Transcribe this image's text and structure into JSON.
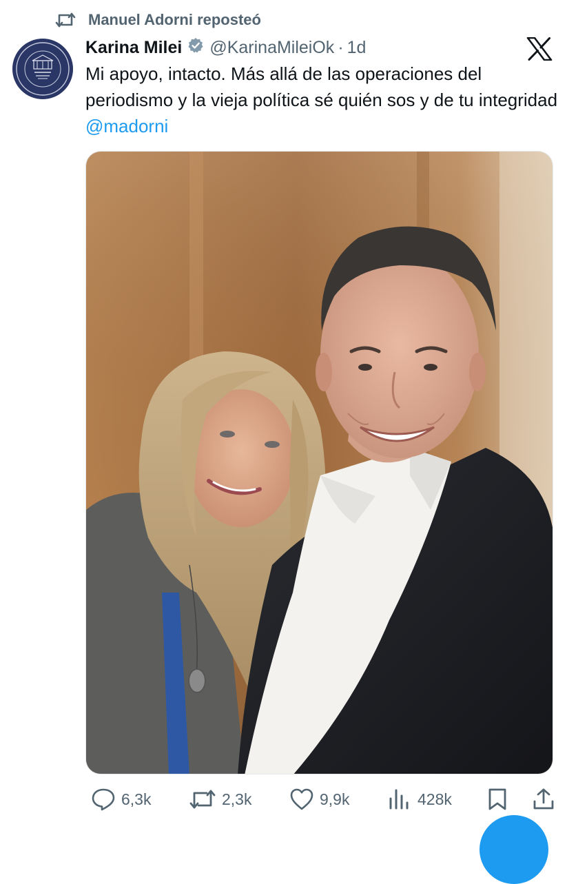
{
  "repost": {
    "label": "Manuel Adorni reposteó",
    "icon": "repost-icon"
  },
  "author": {
    "name": "Karina Milei",
    "handle": "@KarinaMileiOk",
    "separator": "·",
    "time": "1d",
    "verified_icon": "verified-badge-icon",
    "avatar_icon": "secretaria-general-seal"
  },
  "tweet": {
    "text": "Mi apoyo, intacto. Más allá de las operaciones del periodismo y la vieja política sé quién sos y de tu integridad ",
    "mention": "@madorni"
  },
  "brand": {
    "logo": "x-logo"
  },
  "actions": {
    "replies": "6,3k",
    "reposts": "2,3k",
    "likes": "9,9k",
    "views": "428k"
  },
  "colors": {
    "accent": "#1d9bf0",
    "text": "#0f1419",
    "muted": "#536471"
  }
}
